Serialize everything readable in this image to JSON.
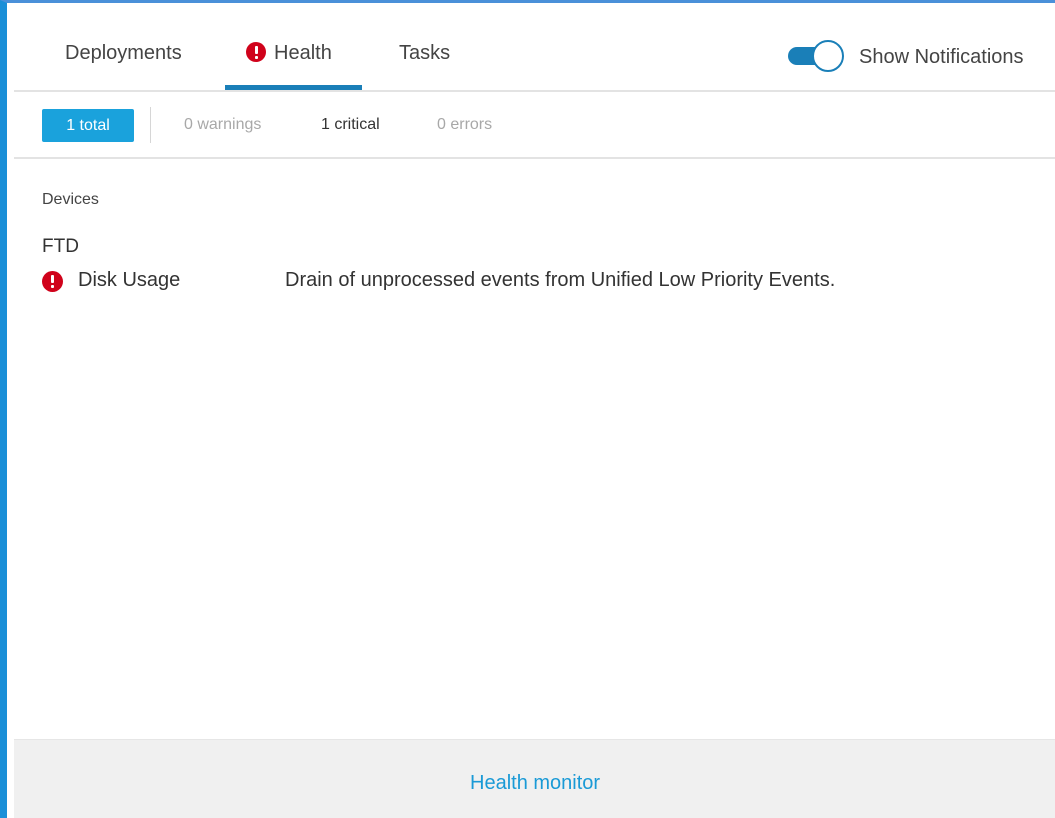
{
  "tabs": {
    "deployments": "Deployments",
    "health": "Health",
    "tasks": "Tasks",
    "active": "Health"
  },
  "notifications_toggle": {
    "label": "Show Notifications",
    "enabled": true
  },
  "filters": {
    "total": "1 total",
    "warnings": "0 warnings",
    "critical": "1 critical",
    "errors": "0 errors"
  },
  "content": {
    "section_title": "Devices",
    "device": "FTD",
    "alerts": [
      {
        "name": "Disk Usage",
        "message": "Drain of unprocessed events from Unified Low Priority Events.",
        "severity": "critical"
      }
    ]
  },
  "footer": {
    "link": "Health monitor"
  },
  "colors": {
    "accent": "#1a7fb8",
    "total_badge": "#1aa2dc",
    "critical": "#d0021b",
    "link": "#1a9ad6",
    "frame_border": "#1a8fd8"
  },
  "icons": {
    "critical_alert": "exclamation-circle-icon"
  }
}
